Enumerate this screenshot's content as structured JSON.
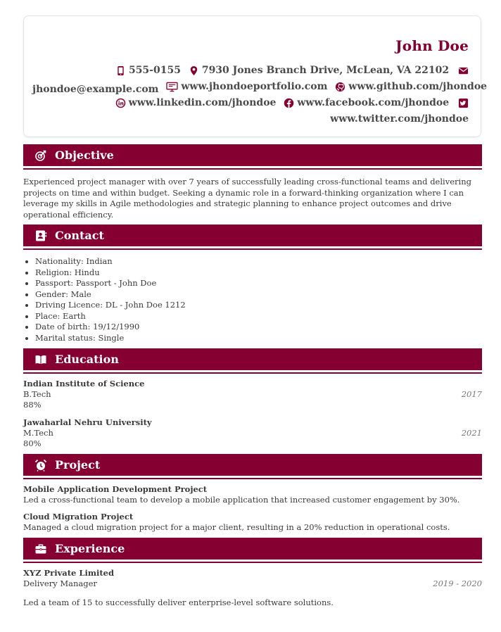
{
  "header": {
    "name": "John Doe",
    "phone": "555-0155",
    "address": "7930 Jones Branch Drive, McLean, VA 22102",
    "email": "jhondoe@example.com",
    "portfolio": "www.jhondoeportfolio.com",
    "github": "www.github.com/jhondoe",
    "linkedin": "www.linkedin.com/jhondoe",
    "facebook": "www.facebook.com/jhondoe",
    "twitter": "www.twitter.com/jhondoe"
  },
  "colors": {
    "accent": "#850030"
  },
  "objective": {
    "title": "Objective",
    "text": "Experienced project manager with over 7 years of successfully leading cross-functional teams and delivering projects on time and within budget. Seeking a dynamic role in a forward-thinking organization where I can leverage my skills in Agile methodologies and strategic planning to enhance project outcomes and drive operational efficiency."
  },
  "contact": {
    "title": "Contact",
    "items": [
      "Nationality: Indian",
      "Religion: Hindu",
      "Passport: Passport - John Doe",
      "Gender: Male",
      "Driving Licence: DL - John Doe 1212",
      "Place: Earth",
      "Date of birth: 19/12/1990",
      "Marital status: Single"
    ]
  },
  "education": {
    "title": "Education",
    "items": [
      {
        "school": "Indian Institute of Science",
        "degree": "B.Tech",
        "score": "88%",
        "year": "2017"
      },
      {
        "school": "Jawaharlal Nehru University",
        "degree": "M.Tech",
        "score": "80%",
        "year": "2021"
      }
    ]
  },
  "project": {
    "title": "Project",
    "items": [
      {
        "name": "Mobile Application Development Project",
        "desc": "Led a cross-functional team to develop a mobile application that increased customer engagement by 30%."
      },
      {
        "name": "Cloud Migration Project",
        "desc": "Managed a cloud migration project for a major client, resulting in a 20% reduction in operational costs."
      }
    ]
  },
  "experience": {
    "title": "Experience",
    "items": [
      {
        "company": "XYZ Private Limited",
        "role": "Delivery Manager",
        "dates": "2019 - 2020",
        "desc": "Led a team of 15 to successfully deliver enterprise-level software solutions."
      }
    ]
  }
}
